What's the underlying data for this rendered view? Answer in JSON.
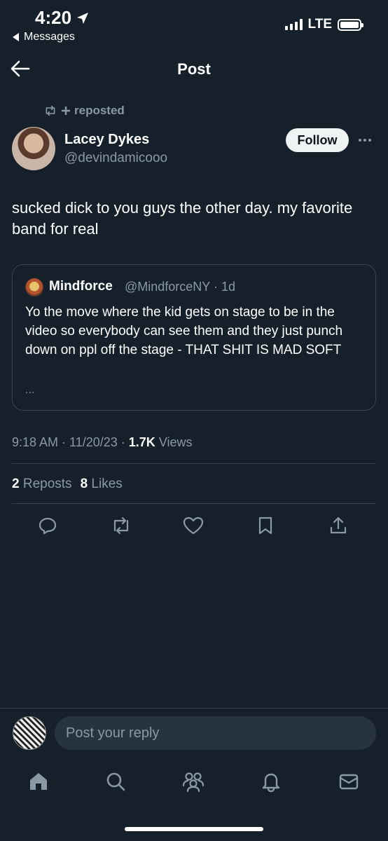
{
  "status_bar": {
    "time": "4:20",
    "back_app": "Messages",
    "network": "LTE"
  },
  "header": {
    "title": "Post",
    "back_icon": "arrow-left-icon"
  },
  "post": {
    "repost_label": "reposted",
    "author_name": "Lacey Dykes",
    "author_handle": "@devindamicooo",
    "follow_label": "Follow",
    "text": "sucked dick to you guys the other day. my favorite band for real",
    "quote": {
      "name": "Mindforce",
      "meta": "@MindforceNY · 1d",
      "text": "Yo the move where the kid gets on stage to be in the video so everybody can see them and they just punch down on ppl off the stage - THAT SHIT IS MAD SOFT",
      "ellipsis": "..."
    },
    "timestamp": "9:18 AM · 11/20/23 · ",
    "views_count": "1.7K",
    "views_label": "Views",
    "reposts_count": "2",
    "reposts_label": "Reposts",
    "likes_count": "8",
    "likes_label": "Likes"
  },
  "actions": [
    "reply-icon",
    "repost-icon",
    "like-icon",
    "bookmark-icon",
    "share-icon"
  ],
  "reply": {
    "placeholder": "Post your reply"
  },
  "bottom_nav": [
    "home-icon",
    "search-icon",
    "communities-icon",
    "notifications-icon",
    "messages-icon"
  ],
  "colors": {
    "background": "#15202b",
    "text_secondary": "#8b98a5",
    "border": "#38444d"
  }
}
